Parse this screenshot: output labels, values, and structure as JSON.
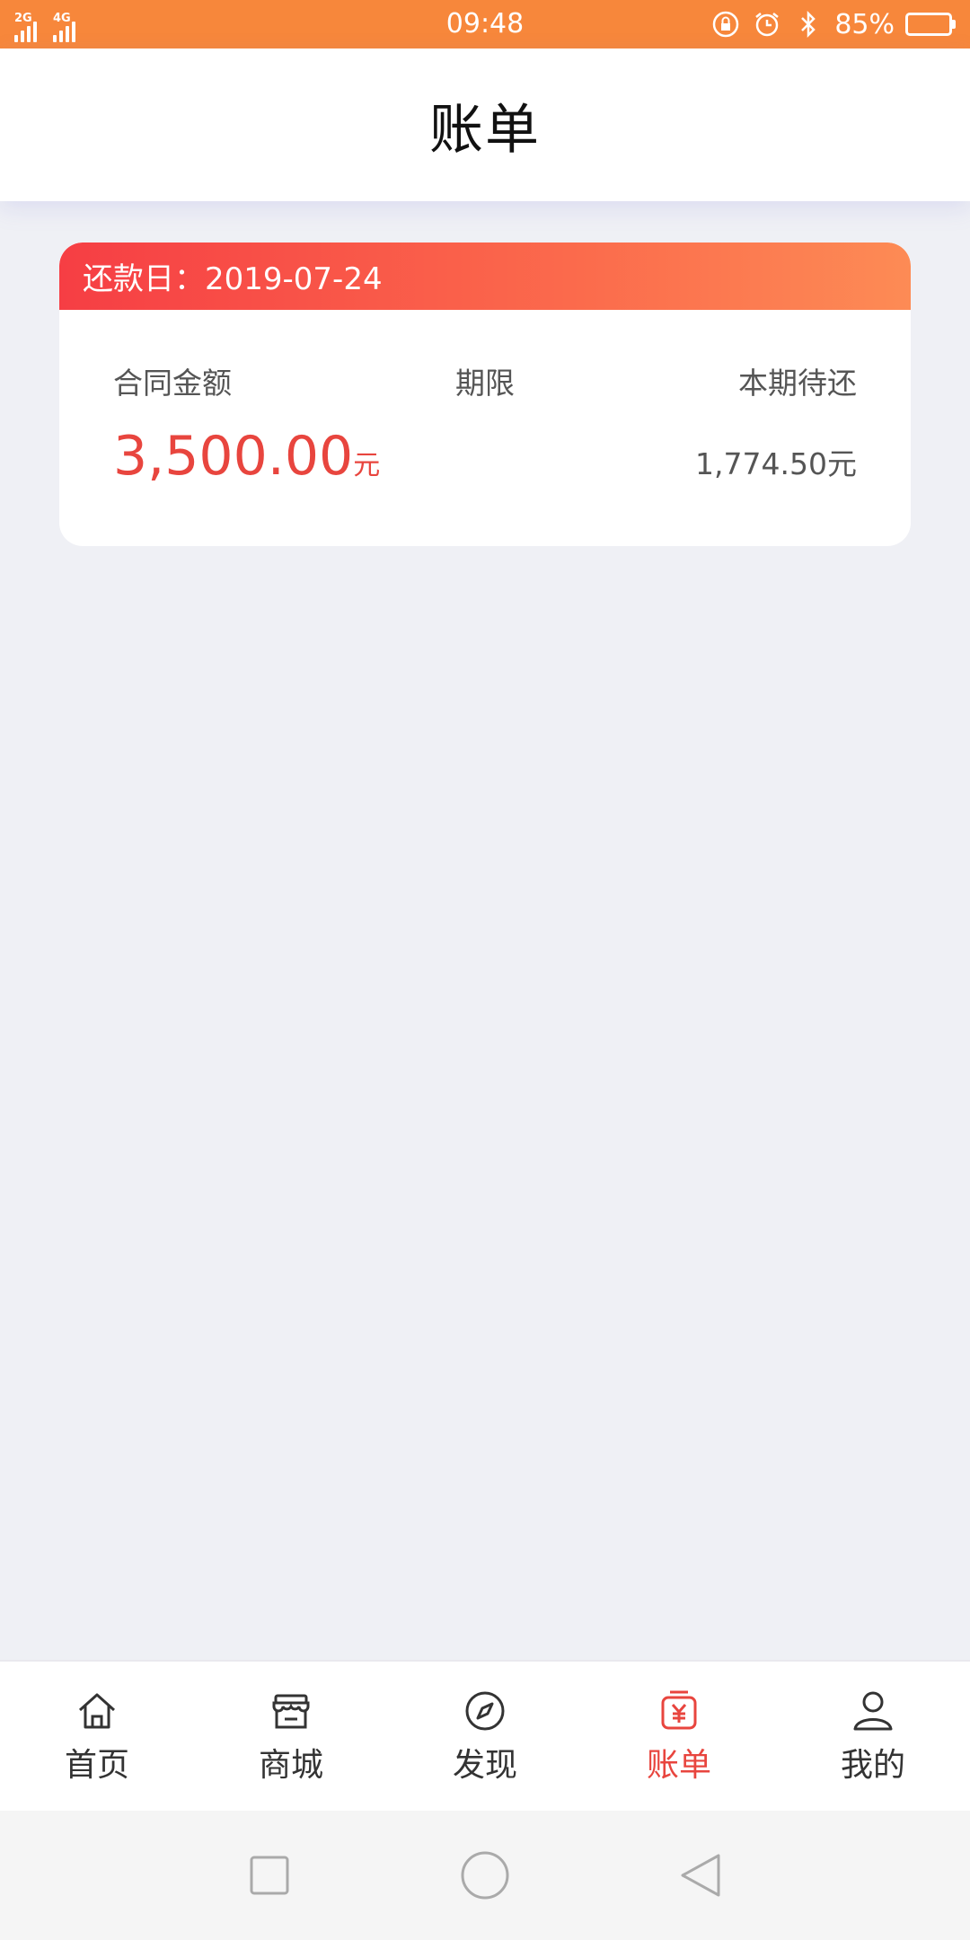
{
  "status_bar": {
    "signal1_label": "2G",
    "signal2_label": "4G",
    "time": "09:48",
    "battery_percent": "85%",
    "battery_level": 0.85
  },
  "header": {
    "title": "账单"
  },
  "bill": {
    "due_date_label": "还款日：2019-07-24",
    "columns": {
      "contract_amount": "合同金额",
      "term": "期限",
      "current_due": "本期待还"
    },
    "contract_amount_value": "3,500.00",
    "contract_amount_unit": "元",
    "term_value": "",
    "current_due_value": "1,774.50元"
  },
  "tabs": [
    {
      "label": "首页",
      "icon": "home-icon"
    },
    {
      "label": "商城",
      "icon": "store-icon"
    },
    {
      "label": "发现",
      "icon": "compass-icon"
    },
    {
      "label": "账单",
      "icon": "bill-icon",
      "active": true
    },
    {
      "label": "我的",
      "icon": "user-icon"
    }
  ],
  "colors": {
    "status_bar": "#f7873b",
    "accent": "#e8453e",
    "card_gradient_start": "#f63e44",
    "card_gradient_end": "#fd8b55",
    "background": "#eff0f5"
  }
}
